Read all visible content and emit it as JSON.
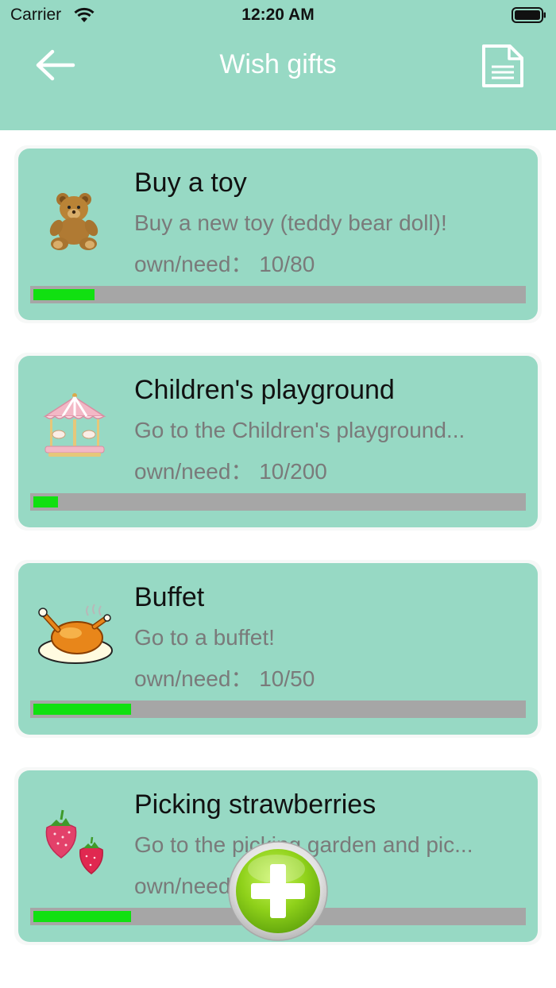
{
  "status": {
    "carrier": "Carrier",
    "time": "12:20 AM"
  },
  "header": {
    "title": "Wish gifts",
    "background_color": "#97d9c4"
  },
  "cards": [
    {
      "title": "Buy a toy",
      "description": "Buy a new toy (teddy bear doll)!",
      "progress_text": "own/need： 10/80",
      "own": 10,
      "need": 80,
      "icon": "teddy-bear-icon"
    },
    {
      "title": "Children's playground",
      "description": "Go to the Children's playground...",
      "progress_text": "own/need： 10/200",
      "own": 10,
      "need": 200,
      "icon": "carousel-icon"
    },
    {
      "title": "Buffet",
      "description": "Go to a buffet!",
      "progress_text": "own/need： 10/50",
      "own": 10,
      "need": 50,
      "icon": "roast-chicken-icon"
    },
    {
      "title": "Picking strawberries",
      "description": "Go to the picking garden and pic...",
      "progress_text": "own/need： 10/50",
      "own": 10,
      "need": 50,
      "icon": "strawberry-icon"
    }
  ],
  "colors": {
    "card_bg": "#97d9c4",
    "progress_fill": "#11e011",
    "progress_track": "#a6a6a6",
    "add_button": "#8fd11a"
  }
}
